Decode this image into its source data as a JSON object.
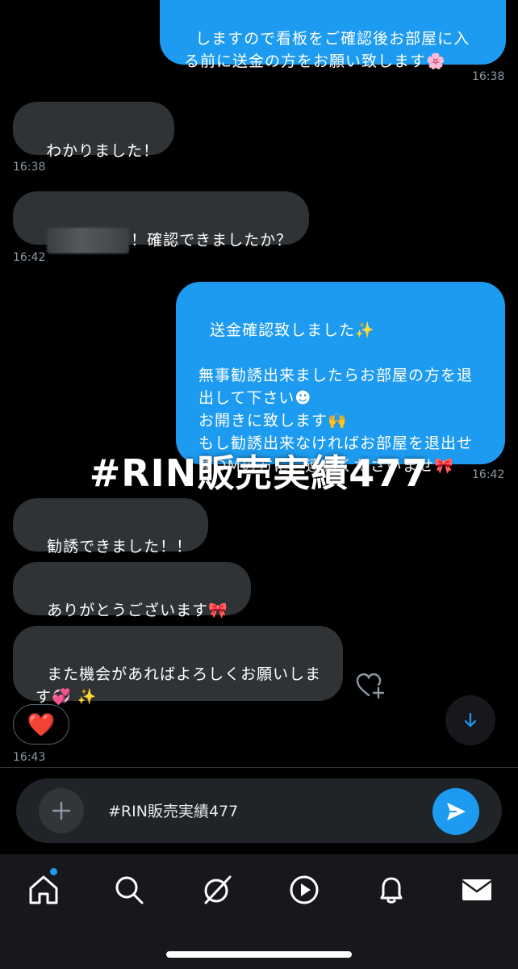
{
  "messages": [
    {
      "text": "しますので看板をご確認後お部屋に入\nる前に送金の方をお願い致します🌸",
      "time": "16:38"
    },
    {
      "text": "わかりました！",
      "time": "16:38"
    },
    {
      "text": "！確認できましたか？",
      "time": "16:42"
    },
    {
      "text": "送金確認致しました✨\n\n無事勧誘出来ましたらお部屋の方を退\n出して下さい☻\nお開きに致します🙌\nもし勧誘出来なければお部屋を退出せ\nずDMの方にご連絡くださいませ🎀",
      "time": "16:42"
    },
    {
      "text": "勧誘できました！！"
    },
    {
      "text": "ありがとうございます🎀"
    },
    {
      "text": "また機会があればよろしくお願いしま\nす💞 ✨",
      "time": "16:43"
    }
  ],
  "reaction": "❤️",
  "overlay_text": "#RIN販売実績477",
  "composer": {
    "text": "#RIN販売実績477"
  },
  "colors": {
    "accent": "#1d9bf0",
    "incoming": "#2f3336",
    "background": "#000000"
  },
  "icons": {
    "add": "plus-icon",
    "send": "send-icon",
    "scroll": "arrow-down-icon",
    "react": "heart-plus-icon",
    "nav": [
      "home-icon",
      "search-icon",
      "grok-icon",
      "video-icon",
      "bell-icon",
      "mail-icon"
    ]
  }
}
